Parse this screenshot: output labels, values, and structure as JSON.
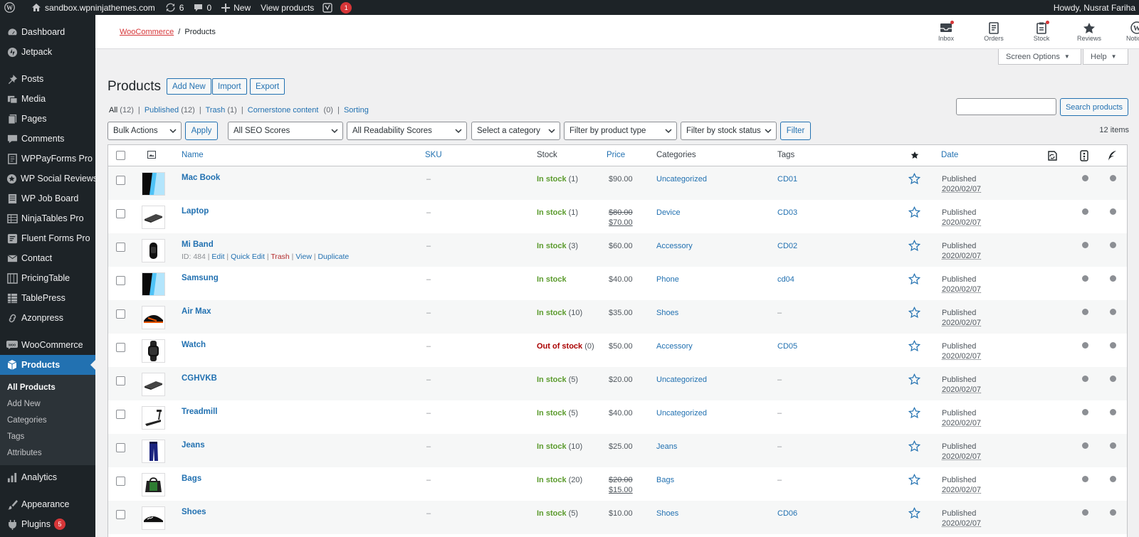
{
  "adminbar": {
    "site": "sandbox.wpninjathemes.com",
    "updates": "6",
    "comments": "0",
    "new": "New",
    "view": "View products",
    "yoast_count": "1",
    "howdy": "Howdy, Nusrat Fariha"
  },
  "sidebar": {
    "items": [
      {
        "label": "Dashboard"
      },
      {
        "label": "Jetpack"
      },
      {
        "label": "Posts"
      },
      {
        "label": "Media"
      },
      {
        "label": "Pages"
      },
      {
        "label": "Comments"
      },
      {
        "label": "WPPayForms Pro"
      },
      {
        "label": "WP Social Reviews"
      },
      {
        "label": "WP Job Board"
      },
      {
        "label": "NinjaTables Pro"
      },
      {
        "label": "Fluent Forms Pro"
      },
      {
        "label": "Contact"
      },
      {
        "label": "PricingTable"
      },
      {
        "label": "TablePress"
      },
      {
        "label": "Azonpress"
      },
      {
        "label": "WooCommerce"
      },
      {
        "label": "Products"
      }
    ],
    "submenu": [
      "All Products",
      "Add New",
      "Categories",
      "Tags",
      "Attributes"
    ],
    "analytics": "Analytics",
    "appearance": "Appearance",
    "plugins": "Plugins",
    "plugins_badge": "5"
  },
  "header": {
    "breadcrumb_root": "WooCommerce",
    "breadcrumb_sep": "/",
    "breadcrumb_current": "Products",
    "actions": [
      "Inbox",
      "Orders",
      "Stock",
      "Reviews",
      "Notices"
    ],
    "screen_options": "Screen Options",
    "help": "Help"
  },
  "page": {
    "title": "Products",
    "add_new": "Add New",
    "import": "Import",
    "export": "Export",
    "views": {
      "all": "All",
      "all_count": "(12)",
      "published": "Published",
      "published_count": "(12)",
      "trash": "Trash",
      "trash_count": "(1)",
      "cornerstone": "Cornerstone content",
      "cornerstone_count": "(0)",
      "sorting": "Sorting"
    },
    "search_button": "Search products",
    "bulk_actions": "Bulk Actions",
    "apply": "Apply",
    "seo": "All SEO Scores",
    "readability": "All Readability Scores",
    "category": "Select a category",
    "product_type": "Filter by product type",
    "stock_status": "Filter by stock status",
    "filter": "Filter",
    "items_count": "12 items"
  },
  "table": {
    "headers": {
      "name": "Name",
      "sku": "SKU",
      "stock": "Stock",
      "price": "Price",
      "categories": "Categories",
      "tags": "Tags",
      "date": "Date"
    },
    "rows": [
      {
        "name": "Mac Book",
        "sku": "–",
        "stock": "In stock",
        "qty": "(1)",
        "price": "$90.00",
        "sale": "",
        "category": "Uncategorized",
        "tag": "CD01",
        "status": "Published",
        "date": "2020/02/07"
      },
      {
        "name": "Laptop",
        "sku": "–",
        "stock": "In stock",
        "qty": "(1)",
        "price": "$80.00",
        "sale": "$70.00",
        "category": "Device",
        "tag": "CD03",
        "status": "Published",
        "date": "2020/02/07"
      },
      {
        "name": "Mi Band",
        "sku": "–",
        "stock": "In stock",
        "qty": "(3)",
        "price": "$60.00",
        "sale": "",
        "category": "Accessory",
        "tag": "CD02",
        "status": "Published",
        "date": "2020/02/07"
      },
      {
        "name": "Samsung",
        "sku": "–",
        "stock": "In stock",
        "qty": "",
        "price": "$40.00",
        "sale": "",
        "category": "Phone",
        "tag": "cd04",
        "status": "Published",
        "date": "2020/02/07"
      },
      {
        "name": "Air Max",
        "sku": "–",
        "stock": "In stock",
        "qty": "(10)",
        "price": "$35.00",
        "sale": "",
        "category": "Shoes",
        "tag": "–",
        "status": "Published",
        "date": "2020/02/07"
      },
      {
        "name": "Watch",
        "sku": "–",
        "stock": "Out of stock",
        "qty": "(0)",
        "price": "$50.00",
        "sale": "",
        "category": "Accessory",
        "tag": "CD05",
        "status": "Published",
        "date": "2020/02/07"
      },
      {
        "name": "CGHVKB",
        "sku": "–",
        "stock": "In stock",
        "qty": "(5)",
        "price": "$20.00",
        "sale": "",
        "category": "Uncategorized",
        "tag": "–",
        "status": "Published",
        "date": "2020/02/07"
      },
      {
        "name": "Treadmill",
        "sku": "–",
        "stock": "In stock",
        "qty": "(5)",
        "price": "$40.00",
        "sale": "",
        "category": "Uncategorized",
        "tag": "–",
        "status": "Published",
        "date": "2020/02/07"
      },
      {
        "name": "Jeans",
        "sku": "–",
        "stock": "In stock",
        "qty": "(10)",
        "price": "$25.00",
        "sale": "",
        "category": "Jeans",
        "tag": "–",
        "status": "Published",
        "date": "2020/02/07"
      },
      {
        "name": "Bags",
        "sku": "–",
        "stock": "In stock",
        "qty": "(20)",
        "price": "$20.00",
        "sale": "$15.00",
        "category": "Bags",
        "tag": "–",
        "status": "Published",
        "date": "2020/02/07"
      },
      {
        "name": "Shoes",
        "sku": "–",
        "stock": "In stock",
        "qty": "(5)",
        "price": "$10.00",
        "sale": "",
        "category": "Shoes",
        "tag": "CD06",
        "status": "Published",
        "date": "2020/02/07"
      }
    ],
    "row_actions": {
      "id": "ID: 484",
      "edit": "Edit",
      "quick_edit": "Quick Edit",
      "trash": "Trash",
      "view": "View",
      "duplicate": "Duplicate"
    }
  },
  "colors": {
    "accent": "#2271b1",
    "instock": "#5b9b2d",
    "outstock": "#aa0000",
    "adminbar": "#1d2327",
    "active_menu": "#2271b1"
  }
}
